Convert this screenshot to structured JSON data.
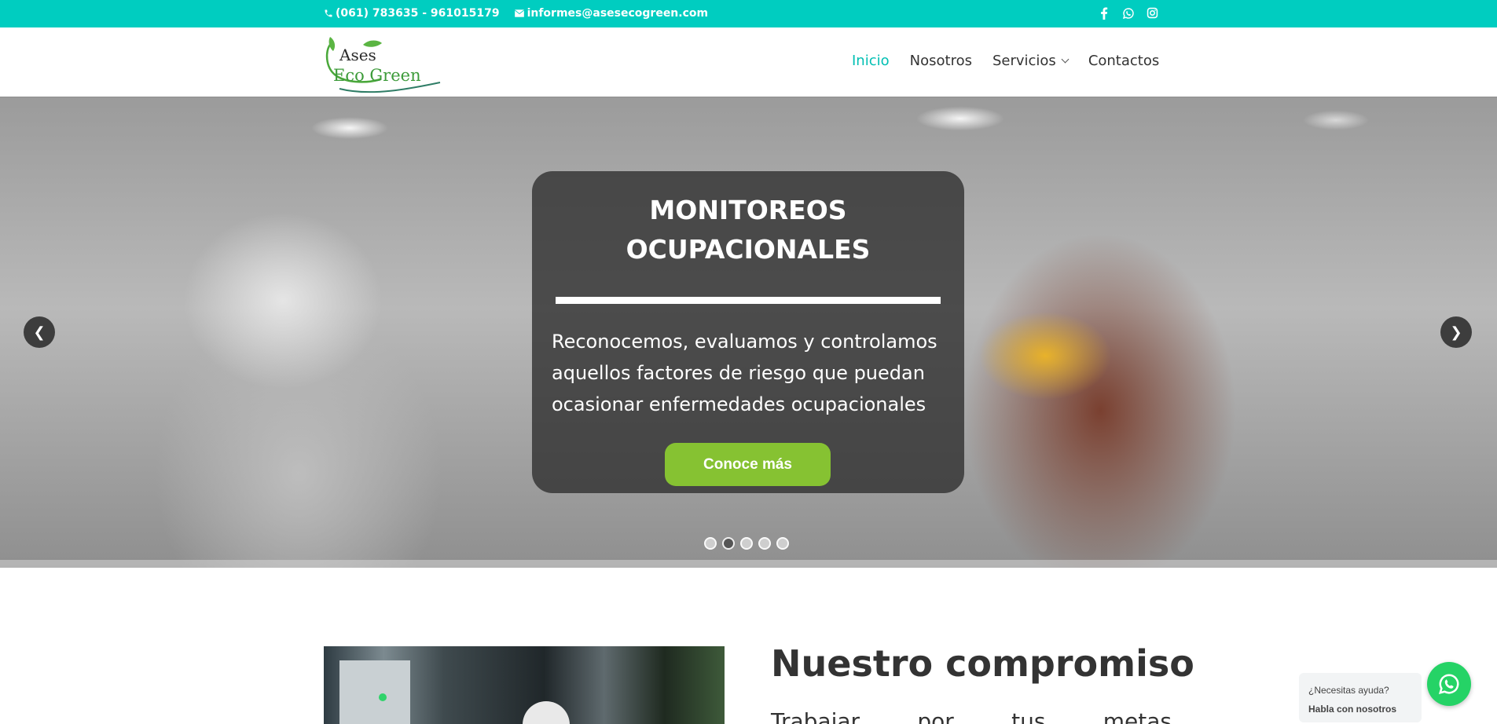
{
  "topbar": {
    "phone": "(061) 783635 - 961015179",
    "email": "informes@asesecogreen.com",
    "social_icons": [
      "facebook-icon",
      "whatsapp-icon",
      "instagram-icon"
    ]
  },
  "brand": {
    "logo_line1": "Ases",
    "logo_line2": "Eco Green"
  },
  "nav": {
    "items": [
      "Inicio",
      "Nosotros",
      "Servicios",
      "Contactos"
    ],
    "active": "Inicio"
  },
  "hero": {
    "title_line1": "MONITOREOS",
    "title_line2": "OCUPACIONALES",
    "description": "Reconocemos, evaluamos y controlamos aquellos factores de riesgo que puedan ocasionar enfermedades ocupacionales",
    "cta": "Conoce más",
    "slide_count": 5,
    "active_slide": 2
  },
  "section": {
    "title": "Nuestro compromiso",
    "text_words": [
      "Trabajar",
      "por",
      "tus",
      "metas"
    ]
  },
  "whatsapp": {
    "prompt": "¿Necesitas ayuda?",
    "cta": "Habla con nosotros"
  },
  "colors": {
    "topbar": "#00cdc0",
    "nav_active": "#00bfb3",
    "cta": "#86c232",
    "whatsapp": "#25d366"
  }
}
